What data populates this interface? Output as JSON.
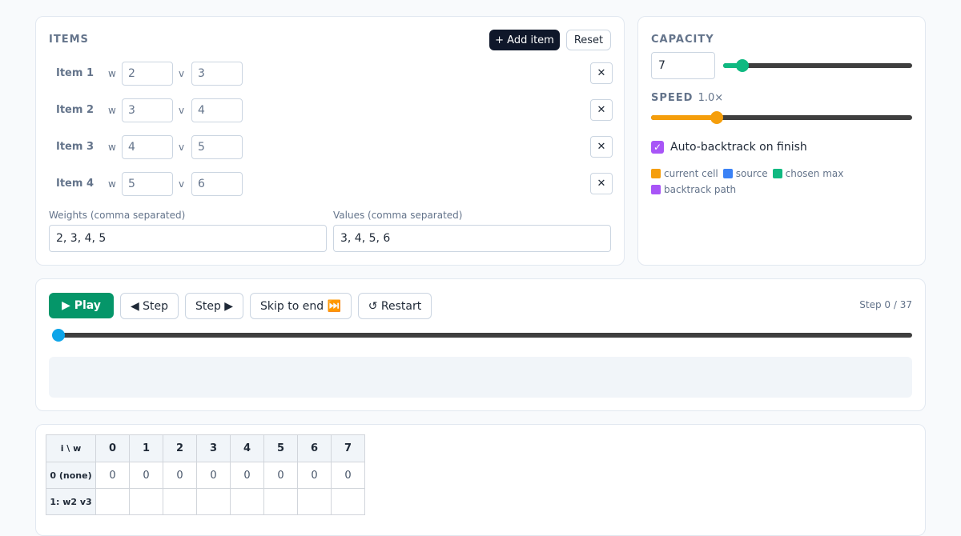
{
  "items": {
    "title": "ITEMS",
    "add_label": "+ Add item",
    "reset_label": "Reset",
    "w_label": "w",
    "v_label": "v",
    "delete_label": "✕",
    "rows": [
      {
        "label": "Item 1",
        "w": "2",
        "v": "3"
      },
      {
        "label": "Item 2",
        "w": "3",
        "v": "4"
      },
      {
        "label": "Item 3",
        "w": "4",
        "v": "5"
      },
      {
        "label": "Item 4",
        "w": "5",
        "v": "6"
      }
    ],
    "weights_label": "Weights (comma separated)",
    "weights_value": "2, 3, 4, 5",
    "values_label": "Values (comma separated)",
    "values_value": "3, 4, 5, 6"
  },
  "capacity": {
    "title": "CAPACITY",
    "value": "7",
    "slider_fraction": 0.1,
    "speed_title": "SPEED",
    "speed_value": "1.0×",
    "speed_fraction": 0.25,
    "auto_backtrack_label": "Auto-backtrack on finish",
    "auto_backtrack_checked": true,
    "legend": [
      {
        "label": "current cell",
        "color": "#f59e0b"
      },
      {
        "label": "source",
        "color": "#3b82f6"
      },
      {
        "label": "chosen max",
        "color": "#10b981"
      },
      {
        "label": "backtrack path",
        "color": "#a855f7"
      }
    ]
  },
  "controls": {
    "play_label": "▶ Play",
    "step_back_label": "◀ Step",
    "step_fwd_label": "Step ▶",
    "skip_label": "Skip to end ⏭️",
    "restart_label": "↺ Restart",
    "step_counter": "Step 0 / 37",
    "progress_fraction": 0
  },
  "table": {
    "corner": "i \\ w",
    "columns": [
      "0",
      "1",
      "2",
      "3",
      "4",
      "5",
      "6",
      "7"
    ],
    "rows": [
      {
        "label": "0 (none)",
        "cells": [
          "0",
          "0",
          "0",
          "0",
          "0",
          "0",
          "0",
          "0"
        ]
      },
      {
        "label": "1: w2 v3",
        "cells": [
          "",
          "",
          "",
          "",
          "",
          "",
          "",
          ""
        ]
      }
    ]
  },
  "colors": {
    "accent_dark": "#0f172a",
    "play_green": "#059669",
    "capacity_slider": "#10b981",
    "speed_slider": "#f59e0b",
    "progress_thumb": "#0ea5e9",
    "checkbox": "#a855f7"
  }
}
